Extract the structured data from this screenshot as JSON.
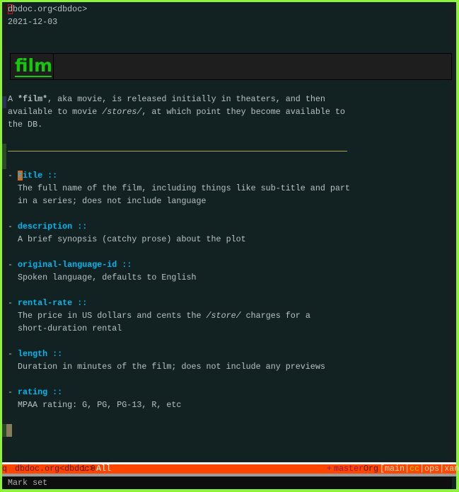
{
  "buffer": {
    "title_line": "dbdoc.org<dbdoc>",
    "date": "2021-12-03",
    "heading": "film",
    "paragraph": {
      "l1_a": "A ",
      "l1_b": "*film*",
      "l1_c": ", aka movie, is released initially in theaters, and then",
      "l2_a": "available to movie ",
      "l2_b": "/stores/",
      "l2_c": ", at which point they become available to",
      "l3": "the DB."
    },
    "fields": [
      {
        "key": "title ::",
        "lines": [
          "The full name of the film, including things like sub-title and part",
          "in a series; does not include language"
        ]
      },
      {
        "key": "description ::",
        "lines": [
          "A brief synopsis (catchy prose) about the plot"
        ]
      },
      {
        "key": "original-language-id ::",
        "lines": [
          "Spoken language, defaults to English"
        ]
      },
      {
        "key": "rental-rate ::",
        "lines_parts": {
          "a": "The price in US dollars and cents the ",
          "b": "/store/",
          "c": " charges for a"
        },
        "lines": [
          "short-duration rental"
        ]
      },
      {
        "key": "length ::",
        "lines": [
          "Duration in minutes of the film; does not include any previews"
        ]
      },
      {
        "key": "rating ::",
        "lines": [
          "MPAA rating: G, PG, PG-13, R, etc"
        ]
      }
    ],
    "dash": "- "
  },
  "modeline": {
    "state": "q",
    "buffer_name": "dbdoc.org<dbdoc>",
    "position": "1:0",
    "scroll": "All",
    "vc_icon": "+",
    "branch": "master",
    "mode": "Org",
    "workspaces_open": "[",
    "workspaces": [
      "main",
      "cc",
      "ops",
      "xan"
    ],
    "workspace_sep": "|",
    "workspaces_close": "]",
    "active_workspace": "cc"
  },
  "echo": "Mark set",
  "colors": {
    "border": "#8cf53a",
    "background": "#122222",
    "key": "#00b8f0",
    "heading": "#16c80c",
    "modeline": "#ff4500"
  }
}
